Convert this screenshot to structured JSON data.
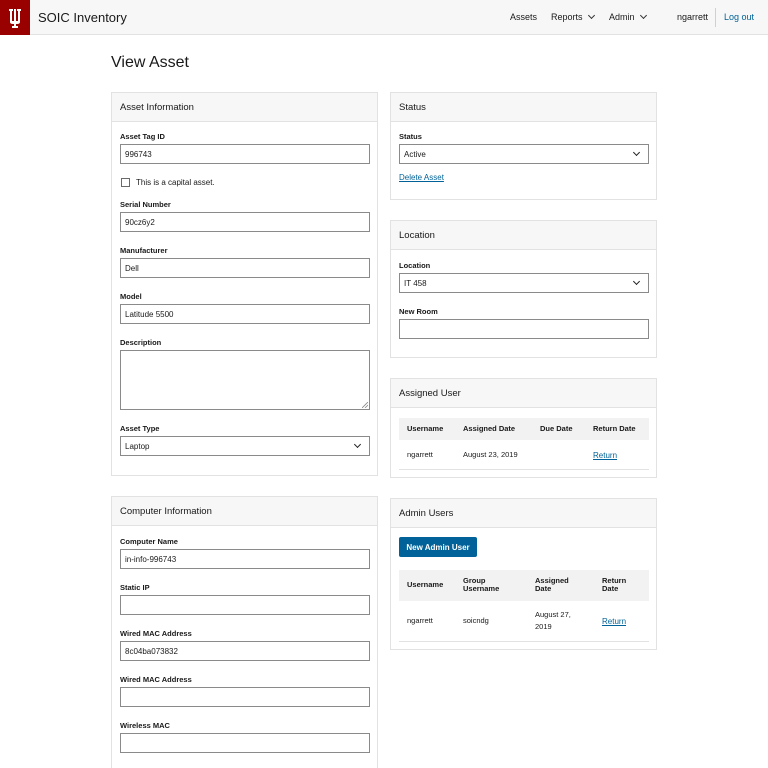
{
  "header": {
    "logo_glyph": "Ψ",
    "app_title": "SOIC Inventory",
    "nav": {
      "assets": "Assets",
      "reports": "Reports",
      "admin": "Admin"
    },
    "username": "ngarrett",
    "logout": "Log out"
  },
  "page_title": "View Asset",
  "asset_info": {
    "heading": "Asset Information",
    "asset_tag_label": "Asset Tag ID",
    "asset_tag_value": "996743",
    "capital_asset_label": "This is a capital asset.",
    "capital_asset_checked": false,
    "serial_label": "Serial Number",
    "serial_value": "90cz6y2",
    "manufacturer_label": "Manufacturer",
    "manufacturer_value": "Dell",
    "model_label": "Model",
    "model_value": "Latitude 5500",
    "description_label": "Description",
    "description_value": "",
    "asset_type_label": "Asset Type",
    "asset_type_value": "Laptop"
  },
  "status": {
    "heading": "Status",
    "status_label": "Status",
    "status_value": "Active",
    "delete_link": "Delete Asset"
  },
  "location": {
    "heading": "Location",
    "location_label": "Location",
    "location_value": "IT 458",
    "new_room_label": "New Room",
    "new_room_value": ""
  },
  "assigned_user": {
    "heading": "Assigned User",
    "columns": [
      "Username",
      "Assigned Date",
      "Due Date",
      "Return Date"
    ],
    "rows": [
      {
        "username": "ngarrett",
        "assigned_date": "August 23, 2019",
        "due_date": "",
        "return_link": "Return"
      }
    ]
  },
  "computer_info": {
    "heading": "Computer Information",
    "computer_name_label": "Computer Name",
    "computer_name_value": "in-info-996743",
    "static_ip_label": "Static IP",
    "static_ip_value": "",
    "wired_mac_label": "Wired MAC Address",
    "wired_mac_value": "8c04ba073832",
    "wired_mac2_label": "Wired MAC Address",
    "wired_mac2_value": "",
    "wireless_mac_label": "Wireless MAC",
    "wireless_mac_value": ""
  },
  "admin_users": {
    "heading": "Admin Users",
    "new_button": "New Admin User",
    "columns": {
      "username": "Username",
      "group_line1": "Group",
      "group_line2": "Username",
      "assigned_line1": "Assigned",
      "assigned_line2": "Date",
      "return_line1": "Return",
      "return_line2": "Date"
    },
    "rows": [
      {
        "username": "ngarrett",
        "group": "soicndg",
        "assigned_line1": "August 27,",
        "assigned_line2": "2019",
        "return_link": "Return"
      }
    ]
  },
  "colors": {
    "brand": "#990000",
    "link": "#006298",
    "button": "#006298"
  }
}
